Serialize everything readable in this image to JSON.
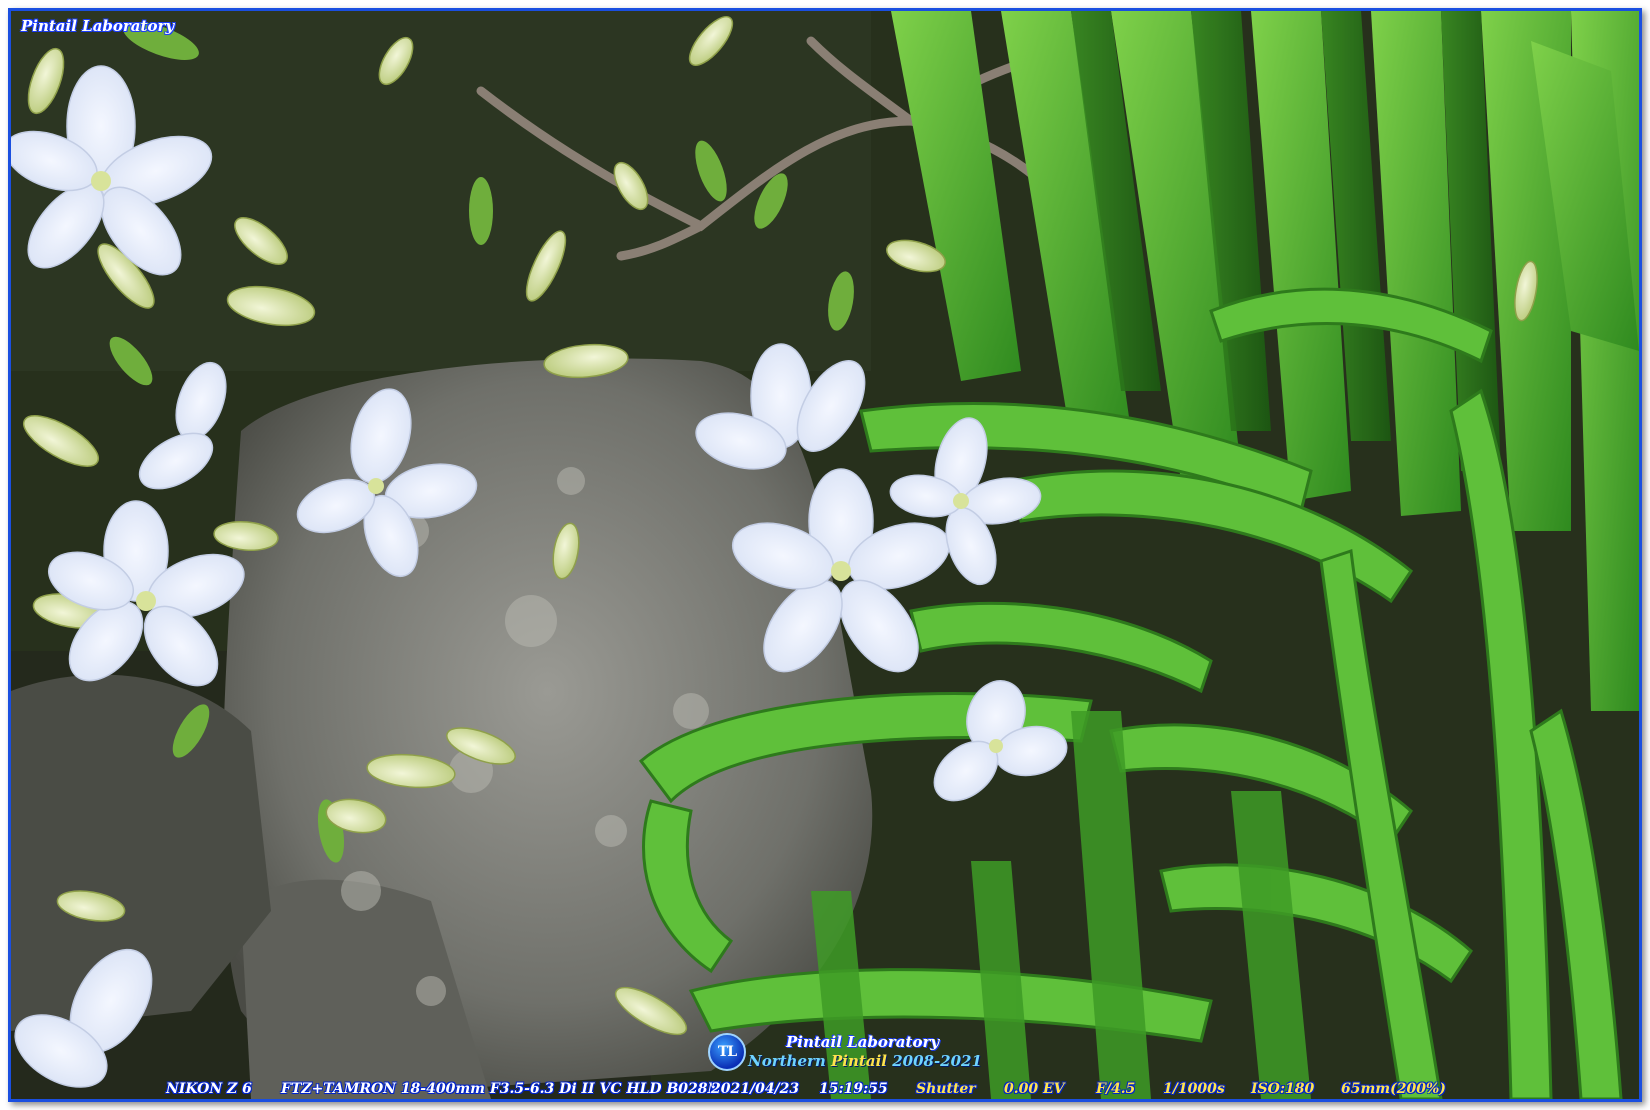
{
  "watermark": {
    "top_left": "Pintail Laboratory",
    "logo_text": "TL",
    "center_line1": "Pintail Laboratory",
    "center_line2_a": "Northern ",
    "center_line2_b": "Pintail",
    "center_line2_c": " 2008-2021"
  },
  "exif": {
    "camera": "NIKON Z 6",
    "lens": "FTZ+TAMRON 18-400mm  F3.5-6.3 Di II VC HLD B028N",
    "date": "2021/04/23",
    "time": "15:19:55",
    "mode": "Shutter",
    "ev": "0.00 EV",
    "aperture": "F/4.5",
    "shutter": "1/1000s",
    "iso": "ISO:180",
    "focal": "65mm(200%)"
  },
  "colors": {
    "frame_border": "#1a4fe0",
    "watermark_accent": "#ffe34d"
  }
}
